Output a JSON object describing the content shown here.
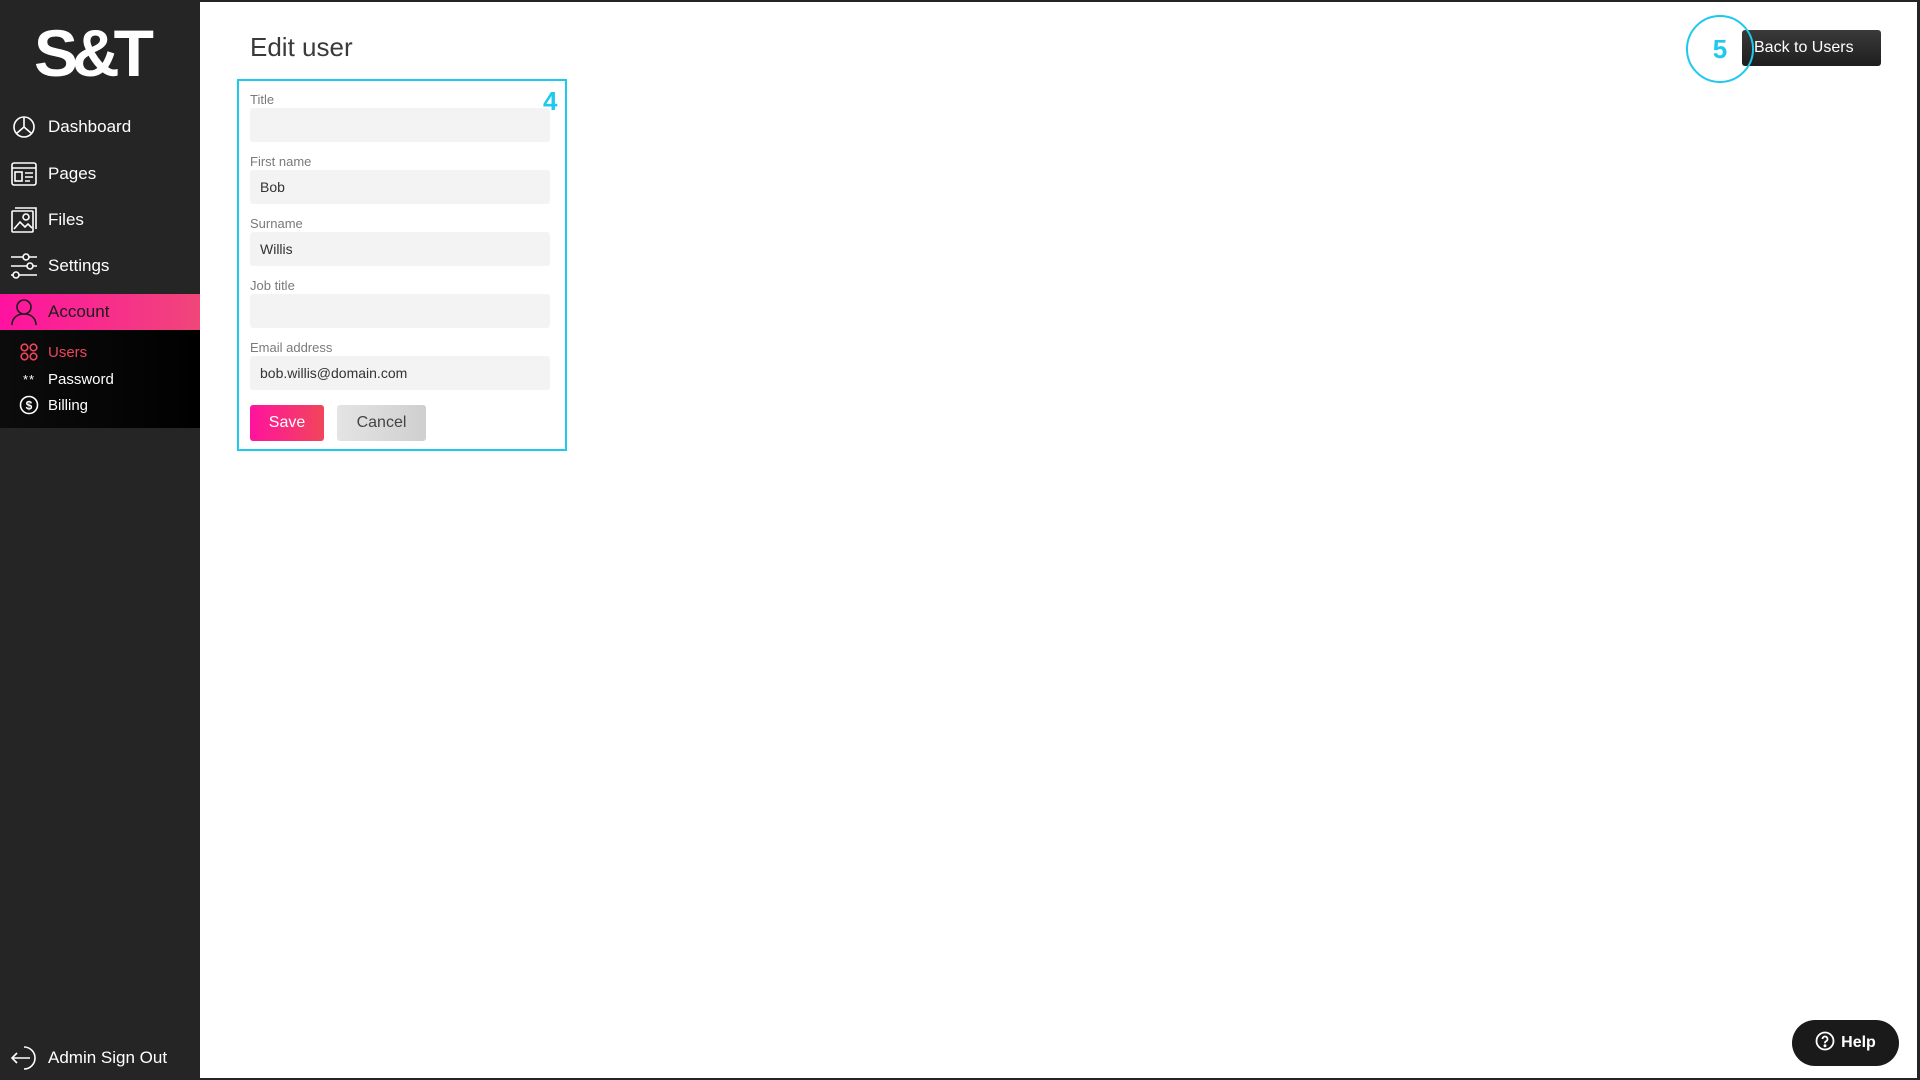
{
  "brand": {
    "logo_text": "S&T",
    "accent": "#ff139e",
    "annotation_color": "#1ec8ef"
  },
  "sidebar": {
    "items": [
      {
        "label": "Dashboard",
        "icon": "dashboard-icon"
      },
      {
        "label": "Pages",
        "icon": "pages-icon"
      },
      {
        "label": "Files",
        "icon": "files-icon"
      },
      {
        "label": "Settings",
        "icon": "settings-icon"
      },
      {
        "label": "Account",
        "icon": "account-icon",
        "active": true
      }
    ],
    "submenu": [
      {
        "label": "Users",
        "icon": "users-icon",
        "active": true
      },
      {
        "label": "Password",
        "icon": "password-icon"
      },
      {
        "label": "Billing",
        "icon": "billing-icon"
      }
    ],
    "signout_label": "Admin Sign Out"
  },
  "main": {
    "title": "Edit user",
    "back_button_label": "Back to Users",
    "annotations": {
      "form": "4",
      "back": "5"
    },
    "form": {
      "fields": [
        {
          "label": "Title",
          "value": ""
        },
        {
          "label": "First name",
          "value": "Bob"
        },
        {
          "label": "Surname",
          "value": "Willis"
        },
        {
          "label": "Job title",
          "value": ""
        },
        {
          "label": "Email address",
          "value": "bob.willis@domain.com"
        }
      ],
      "save_label": "Save",
      "cancel_label": "Cancel"
    },
    "help_label": "Help"
  }
}
